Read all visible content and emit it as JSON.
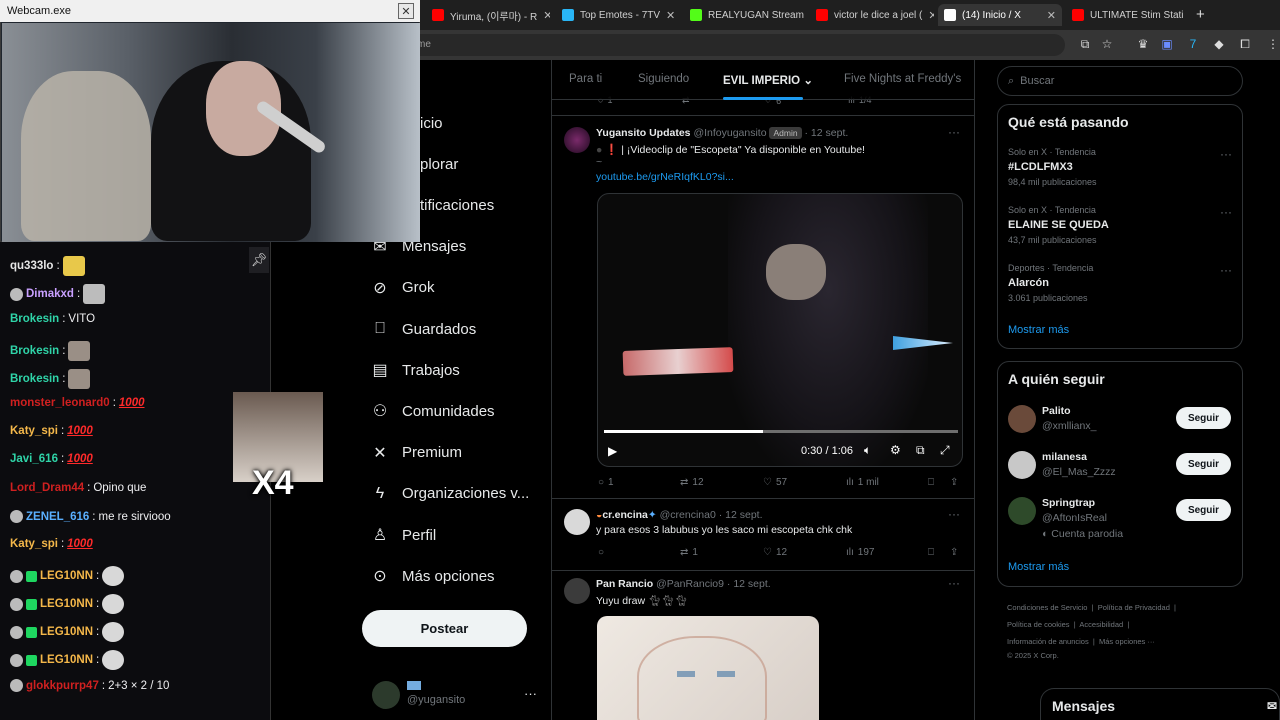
{
  "browser": {
    "tabs": [
      {
        "label": "Yiruma, (이루마) - R",
        "color": "#ff0000"
      },
      {
        "label": "Top Emotes - 7TV",
        "color": "#29b6f6"
      },
      {
        "label": "REALYUGAN Stream",
        "color": "#53fc18"
      },
      {
        "label": "victor le dice a joel (",
        "color": "#ff0000"
      },
      {
        "label": "(14) Inicio / X",
        "color": "#ffffff"
      },
      {
        "label": "ULTIMATE Stim Stati",
        "color": "#ff0000"
      }
    ],
    "new_tab": "+",
    "url": "me"
  },
  "webcam": {
    "title": "Webcam.exe",
    "close": "✕"
  },
  "chat": {
    "messages": [
      {
        "user": "qu333lo",
        "color": "#e6e6e6",
        "text": ""
      },
      {
        "user": "Dimakxd",
        "color": "#c9a0ff",
        "text": ""
      },
      {
        "user": "Brokesin",
        "color": "#2fd4a8",
        "text": "VITO"
      },
      {
        "user": "Brokesin",
        "color": "#2fd4a8",
        "text": ""
      },
      {
        "user": "Brokesin",
        "color": "#2fd4a8",
        "text": ""
      },
      {
        "user": "monster_leonard0",
        "color": "#d02020",
        "text": "1000"
      },
      {
        "user": "Katy_spi",
        "color": "#f5b84a",
        "text": "1000"
      },
      {
        "user": "Javi_616",
        "color": "#2fd4a8",
        "text": "1000"
      },
      {
        "user": "Lord_Dram44",
        "color": "#d02020",
        "text": "Opino que"
      },
      {
        "user": "ZENEL_616",
        "color": "#5ab0ff",
        "text": "me re sirviooo"
      },
      {
        "user": "Katy_spi",
        "color": "#f5b84a",
        "text": "1000"
      },
      {
        "user": "LEG10NN",
        "color": "#f5b84a",
        "text": ""
      },
      {
        "user": "LEG10NN",
        "color": "#f5b84a",
        "text": ""
      },
      {
        "user": "LEG10NN",
        "color": "#f5b84a",
        "text": ""
      },
      {
        "user": "LEG10NN",
        "color": "#f5b84a",
        "text": ""
      },
      {
        "user": "glokkpurrp47",
        "color": "#d02020",
        "text": "2+3 × 2 / 10"
      }
    ],
    "x4": "X4"
  },
  "nav": {
    "items": [
      {
        "label": "Inicio",
        "icon": "home-icon"
      },
      {
        "label": "Explorar",
        "icon": "search-icon"
      },
      {
        "label": "Notificaciones",
        "icon": "bell-icon"
      },
      {
        "label": "Mensajes",
        "icon": "envelope-icon"
      },
      {
        "label": "Grok",
        "icon": "grok-icon"
      },
      {
        "label": "Guardados",
        "icon": "bookmark-icon"
      },
      {
        "label": "Trabajos",
        "icon": "briefcase-icon"
      },
      {
        "label": "Comunidades",
        "icon": "people-icon"
      },
      {
        "label": "Premium",
        "icon": "x-logo-icon"
      },
      {
        "label": "Organizaciones v...",
        "icon": "lightning-icon"
      },
      {
        "label": "Perfil",
        "icon": "person-icon"
      },
      {
        "label": "Más opciones",
        "icon": "more-circle-icon"
      }
    ],
    "visible_fragments": [
      "icio",
      "plorar",
      "tificaciones"
    ],
    "post_button": "Postear",
    "account_handle": "@yugansito"
  },
  "timeline": {
    "tabs": [
      "Para ti",
      "Siguiendo",
      "EVIL IMPERIO",
      "Five Nights at Freddy's"
    ],
    "active_tab": "EVIL IMPERIO",
    "prev_actions": {
      "replies": "1",
      "likes": "6",
      "views": "1/4"
    },
    "tweets": [
      {
        "name": "Yugansito Updates",
        "handle": "@Infoyugansito",
        "badge": "Admin",
        "date": "12 sept.",
        "text": "❗ | ¡Videoclip de \"Escopeta\" Ya disponible en Youtube!",
        "text2": "~",
        "link": "youtube.be/grNeRIqfKL0?si...",
        "video": {
          "time": "0:30 / 1:06",
          "progress": 0.45
        },
        "replies": "1",
        "reposts": "12",
        "likes": "57",
        "views": "1 mil"
      },
      {
        "name": "cr.encina",
        "handle": "@crencina0",
        "date": "12 sept.",
        "text": "y para esos 3 labubus yo les saco mi escopeta chk chk",
        "replies": "",
        "reposts": "1",
        "likes": "12",
        "views": "197"
      },
      {
        "name": "Pan Rancio",
        "handle": "@PanRancio9",
        "date": "12 sept.",
        "text": "Yuyu draw"
      }
    ]
  },
  "sidebar": {
    "search_placeholder": "Buscar",
    "trends_title": "Qué está pasando",
    "trends": [
      {
        "meta": "Solo en X · Tendencia",
        "name": "#LCDLFMX3",
        "count": "98,4 mil publicaciones"
      },
      {
        "meta": "Solo en X · Tendencia",
        "name": "ELAINE SE QUEDA",
        "count": "43,7 mil publicaciones"
      },
      {
        "meta": "Deportes · Tendencia",
        "name": "Alarcón",
        "count": "3.061 publicaciones"
      }
    ],
    "show_more": "Mostrar más",
    "follow_title": "A quién seguir",
    "follow": [
      {
        "name": "Palito",
        "handle": "@xmllianx_",
        "extra": ""
      },
      {
        "name": "milanesa",
        "handle": "@El_Mas_Zzzz",
        "extra": ""
      },
      {
        "name": "Springtrap",
        "handle": "@AftonIsReal",
        "extra": "Cuenta parodia"
      }
    ],
    "follow_button": "Seguir",
    "footer": {
      "row1": [
        "Condiciones de Servicio",
        "Política de Privacidad"
      ],
      "row2": [
        "Política de cookies",
        "Accesibilidad"
      ],
      "row3": [
        "Información de anuncios",
        "Más opciones ···"
      ],
      "copyright": "© 2025 X Corp."
    },
    "dm_title": "Mensajes"
  }
}
